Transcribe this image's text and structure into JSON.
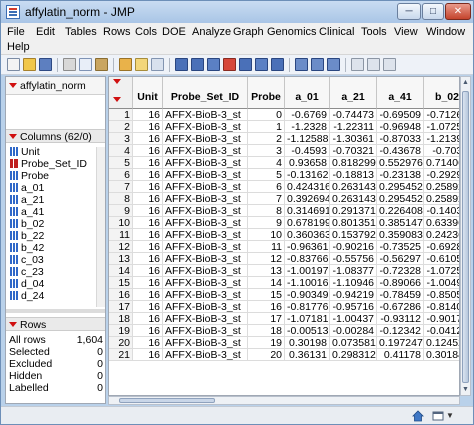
{
  "window": {
    "title": "affylatin_norm - JMP",
    "minimize_glyph": "─",
    "maximize_glyph": "□",
    "close_glyph": "✕"
  },
  "menu": [
    "File",
    "Edit",
    "Tables",
    "Rows",
    "Cols",
    "DOE",
    "Analyze",
    "Graph",
    "Genomics",
    "Clinical",
    "Tools",
    "View",
    "Window",
    "Help"
  ],
  "table_panel": {
    "name": "affylatin_norm"
  },
  "columns_panel": {
    "header": "Columns (62/0)",
    "items": [
      {
        "name": "Unit",
        "type": "continuous"
      },
      {
        "name": "Probe_Set_ID",
        "type": "nominal"
      },
      {
        "name": "Probe",
        "type": "continuous"
      },
      {
        "name": "a_01",
        "type": "continuous"
      },
      {
        "name": "a_21",
        "type": "continuous"
      },
      {
        "name": "a_41",
        "type": "continuous"
      },
      {
        "name": "b_02",
        "type": "continuous"
      },
      {
        "name": "b_22",
        "type": "continuous"
      },
      {
        "name": "b_42",
        "type": "continuous"
      },
      {
        "name": "c_03",
        "type": "continuous"
      },
      {
        "name": "c_23",
        "type": "continuous"
      },
      {
        "name": "d_04",
        "type": "continuous"
      },
      {
        "name": "d_24",
        "type": "continuous"
      }
    ]
  },
  "rows_panel": {
    "header": "Rows",
    "items": [
      {
        "label": "All rows",
        "value": "1,604"
      },
      {
        "label": "Selected",
        "value": "0"
      },
      {
        "label": "Excluded",
        "value": "0"
      },
      {
        "label": "Hidden",
        "value": "0"
      },
      {
        "label": "Labelled",
        "value": "0"
      }
    ]
  },
  "grid": {
    "headers": [
      "Unit",
      "Probe_Set_ID",
      "Probe",
      "a_01",
      "a_21",
      "a_41",
      "b_02"
    ],
    "rows": [
      [
        "1",
        "16",
        "AFFX-BioB-3_st",
        "0",
        "-0.6769",
        "-0.74473",
        "-0.69509",
        "-0.71263"
      ],
      [
        "2",
        "16",
        "AFFX-BioB-3_st",
        "1",
        "-1.2328",
        "-1.22311",
        "-0.96948",
        "-1.07253"
      ],
      [
        "3",
        "16",
        "AFFX-BioB-3_st",
        "2",
        "-1.12588",
        "-1.30361",
        "-0.87033",
        "-1.21398"
      ],
      [
        "4",
        "16",
        "AFFX-BioB-3_st",
        "3",
        "-0.4593",
        "-0.70321",
        "-0.43678",
        "-0.7033"
      ],
      [
        "5",
        "16",
        "AFFX-BioB-3_st",
        "4",
        "0.93658",
        "0.818299",
        "0.552976",
        "0.714067"
      ],
      [
        "6",
        "16",
        "AFFX-BioB-3_st",
        "5",
        "-0.13162",
        "-0.18813",
        "-0.23138",
        "-0.29292"
      ],
      [
        "7",
        "16",
        "AFFX-BioB-3_st",
        "6",
        "0.424316",
        "0.263143",
        "0.295452",
        "0.258925"
      ],
      [
        "8",
        "16",
        "AFFX-BioB-3_st",
        "7",
        "0.392694",
        "0.263143",
        "0.295452",
        "0.258925"
      ],
      [
        "9",
        "16",
        "AFFX-BioB-3_st",
        "8",
        "0.314691",
        "0.291371",
        "0.226408",
        "-0.14036"
      ],
      [
        "10",
        "16",
        "AFFX-BioB-3_st",
        "9",
        "0.678199",
        "0.801351",
        "0.385147",
        "0.633964"
      ],
      [
        "11",
        "16",
        "AFFX-BioB-3_st",
        "10",
        "0.360363",
        "0.153792",
        "0.359083",
        "0.242369"
      ],
      [
        "12",
        "16",
        "AFFX-BioB-3_st",
        "11",
        "-0.96361",
        "-0.90216",
        "-0.73525",
        "-0.69287"
      ],
      [
        "13",
        "16",
        "AFFX-BioB-3_st",
        "12",
        "-0.83766",
        "-0.55756",
        "-0.56297",
        "-0.61059"
      ],
      [
        "14",
        "16",
        "AFFX-BioB-3_st",
        "13",
        "-1.00197",
        "-1.08377",
        "-0.72328",
        "-1.07253"
      ],
      [
        "15",
        "16",
        "AFFX-BioB-3_st",
        "14",
        "-1.10016",
        "-1.10946",
        "-0.89066",
        "-1.00497"
      ],
      [
        "16",
        "16",
        "AFFX-BioB-3_st",
        "15",
        "-0.90349",
        "-0.94219",
        "-0.78459",
        "-0.85059"
      ],
      [
        "17",
        "16",
        "AFFX-BioB-3_st",
        "16",
        "-0.81776",
        "-0.95716",
        "-0.67286",
        "-0.81406"
      ],
      [
        "18",
        "16",
        "AFFX-BioB-3_st",
        "17",
        "-1.07181",
        "-1.00437",
        "-0.93112",
        "-0.90174"
      ],
      [
        "19",
        "16",
        "AFFX-BioB-3_st",
        "18",
        "-0.00513",
        "-0.00284",
        "-0.12342",
        "-0.04127"
      ],
      [
        "20",
        "16",
        "AFFX-BioB-3_st",
        "19",
        "0.30198",
        "0.073581",
        "0.197247",
        "0.124524"
      ],
      [
        "21",
        "16",
        "AFFX-BioB-3_st",
        "20",
        "0.36131",
        "0.298312",
        "0.41178",
        "0.301843"
      ]
    ]
  },
  "colors": {
    "accent_red": "#d01010",
    "continuous_icon": "#2f68c8",
    "nominal_icon": "#c02020",
    "header_bg": "#f7f7f7"
  },
  "icons": [
    "new-table-icon",
    "open-icon",
    "save-icon",
    "cut-icon",
    "copy-icon",
    "paste-icon",
    "journal-icon",
    "report-icon",
    "layout-icon",
    "graph-builder-icon",
    "distribution-icon",
    "fit-model-icon",
    "chart-icon",
    "script-icon",
    "data-icon",
    "group-icon"
  ]
}
